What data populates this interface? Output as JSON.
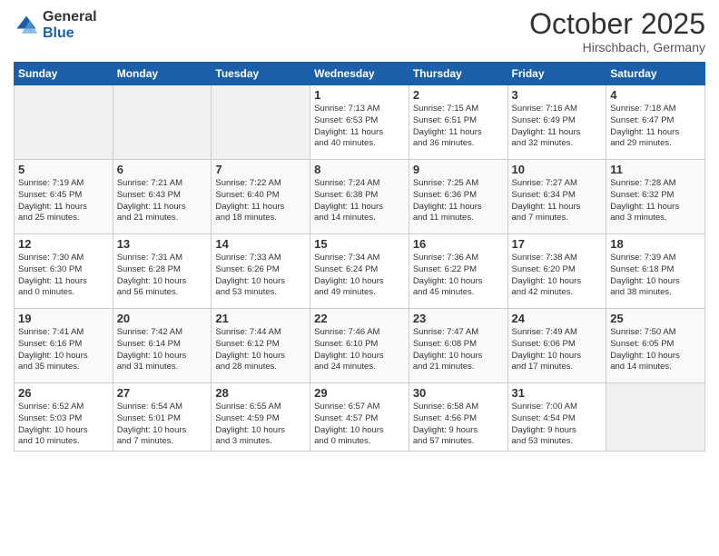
{
  "logo": {
    "general": "General",
    "blue": "Blue"
  },
  "title": {
    "month": "October 2025",
    "location": "Hirschbach, Germany"
  },
  "weekdays": [
    "Sunday",
    "Monday",
    "Tuesday",
    "Wednesday",
    "Thursday",
    "Friday",
    "Saturday"
  ],
  "weeks": [
    [
      {
        "day": "",
        "info": ""
      },
      {
        "day": "",
        "info": ""
      },
      {
        "day": "",
        "info": ""
      },
      {
        "day": "1",
        "info": "Sunrise: 7:13 AM\nSunset: 6:53 PM\nDaylight: 11 hours\nand 40 minutes."
      },
      {
        "day": "2",
        "info": "Sunrise: 7:15 AM\nSunset: 6:51 PM\nDaylight: 11 hours\nand 36 minutes."
      },
      {
        "day": "3",
        "info": "Sunrise: 7:16 AM\nSunset: 6:49 PM\nDaylight: 11 hours\nand 32 minutes."
      },
      {
        "day": "4",
        "info": "Sunrise: 7:18 AM\nSunset: 6:47 PM\nDaylight: 11 hours\nand 29 minutes."
      }
    ],
    [
      {
        "day": "5",
        "info": "Sunrise: 7:19 AM\nSunset: 6:45 PM\nDaylight: 11 hours\nand 25 minutes."
      },
      {
        "day": "6",
        "info": "Sunrise: 7:21 AM\nSunset: 6:43 PM\nDaylight: 11 hours\nand 21 minutes."
      },
      {
        "day": "7",
        "info": "Sunrise: 7:22 AM\nSunset: 6:40 PM\nDaylight: 11 hours\nand 18 minutes."
      },
      {
        "day": "8",
        "info": "Sunrise: 7:24 AM\nSunset: 6:38 PM\nDaylight: 11 hours\nand 14 minutes."
      },
      {
        "day": "9",
        "info": "Sunrise: 7:25 AM\nSunset: 6:36 PM\nDaylight: 11 hours\nand 11 minutes."
      },
      {
        "day": "10",
        "info": "Sunrise: 7:27 AM\nSunset: 6:34 PM\nDaylight: 11 hours\nand 7 minutes."
      },
      {
        "day": "11",
        "info": "Sunrise: 7:28 AM\nSunset: 6:32 PM\nDaylight: 11 hours\nand 3 minutes."
      }
    ],
    [
      {
        "day": "12",
        "info": "Sunrise: 7:30 AM\nSunset: 6:30 PM\nDaylight: 11 hours\nand 0 minutes."
      },
      {
        "day": "13",
        "info": "Sunrise: 7:31 AM\nSunset: 6:28 PM\nDaylight: 10 hours\nand 56 minutes."
      },
      {
        "day": "14",
        "info": "Sunrise: 7:33 AM\nSunset: 6:26 PM\nDaylight: 10 hours\nand 53 minutes."
      },
      {
        "day": "15",
        "info": "Sunrise: 7:34 AM\nSunset: 6:24 PM\nDaylight: 10 hours\nand 49 minutes."
      },
      {
        "day": "16",
        "info": "Sunrise: 7:36 AM\nSunset: 6:22 PM\nDaylight: 10 hours\nand 45 minutes."
      },
      {
        "day": "17",
        "info": "Sunrise: 7:38 AM\nSunset: 6:20 PM\nDaylight: 10 hours\nand 42 minutes."
      },
      {
        "day": "18",
        "info": "Sunrise: 7:39 AM\nSunset: 6:18 PM\nDaylight: 10 hours\nand 38 minutes."
      }
    ],
    [
      {
        "day": "19",
        "info": "Sunrise: 7:41 AM\nSunset: 6:16 PM\nDaylight: 10 hours\nand 35 minutes."
      },
      {
        "day": "20",
        "info": "Sunrise: 7:42 AM\nSunset: 6:14 PM\nDaylight: 10 hours\nand 31 minutes."
      },
      {
        "day": "21",
        "info": "Sunrise: 7:44 AM\nSunset: 6:12 PM\nDaylight: 10 hours\nand 28 minutes."
      },
      {
        "day": "22",
        "info": "Sunrise: 7:46 AM\nSunset: 6:10 PM\nDaylight: 10 hours\nand 24 minutes."
      },
      {
        "day": "23",
        "info": "Sunrise: 7:47 AM\nSunset: 6:08 PM\nDaylight: 10 hours\nand 21 minutes."
      },
      {
        "day": "24",
        "info": "Sunrise: 7:49 AM\nSunset: 6:06 PM\nDaylight: 10 hours\nand 17 minutes."
      },
      {
        "day": "25",
        "info": "Sunrise: 7:50 AM\nSunset: 6:05 PM\nDaylight: 10 hours\nand 14 minutes."
      }
    ],
    [
      {
        "day": "26",
        "info": "Sunrise: 6:52 AM\nSunset: 5:03 PM\nDaylight: 10 hours\nand 10 minutes."
      },
      {
        "day": "27",
        "info": "Sunrise: 6:54 AM\nSunset: 5:01 PM\nDaylight: 10 hours\nand 7 minutes."
      },
      {
        "day": "28",
        "info": "Sunrise: 6:55 AM\nSunset: 4:59 PM\nDaylight: 10 hours\nand 3 minutes."
      },
      {
        "day": "29",
        "info": "Sunrise: 6:57 AM\nSunset: 4:57 PM\nDaylight: 10 hours\nand 0 minutes."
      },
      {
        "day": "30",
        "info": "Sunrise: 6:58 AM\nSunset: 4:56 PM\nDaylight: 9 hours\nand 57 minutes."
      },
      {
        "day": "31",
        "info": "Sunrise: 7:00 AM\nSunset: 4:54 PM\nDaylight: 9 hours\nand 53 minutes."
      },
      {
        "day": "",
        "info": ""
      }
    ]
  ]
}
